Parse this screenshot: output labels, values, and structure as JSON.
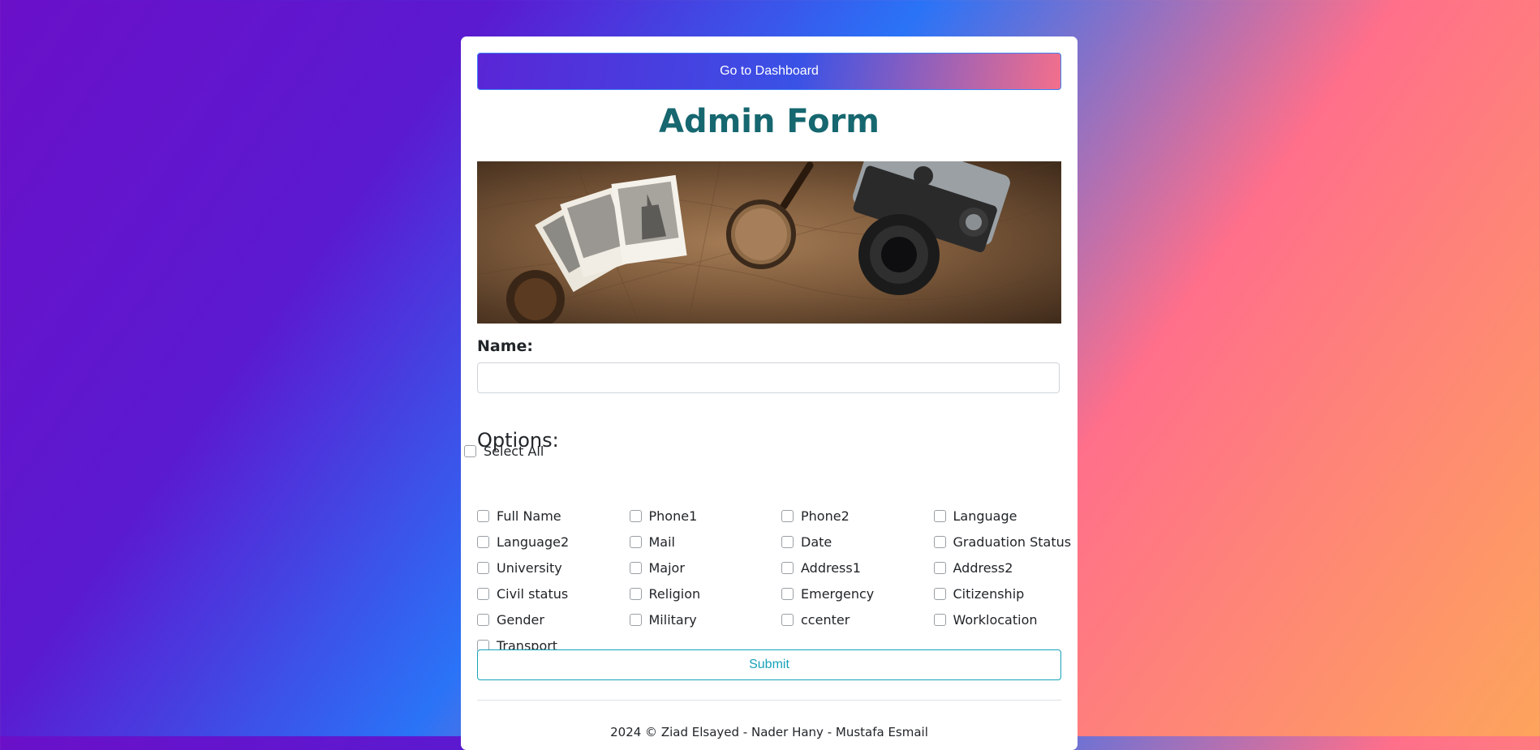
{
  "header": {
    "dashboard_button": "Go to Dashboard"
  },
  "form": {
    "title": "Admin Form",
    "name_label": "Name:",
    "name_value": "",
    "options_title": "Options:",
    "select_all_label": "Select All",
    "options": [
      "Full Name",
      "Phone1",
      "Phone2",
      "Language",
      "Language2",
      "Mail",
      "Date",
      "Graduation Status",
      "University",
      "Major",
      "Address1",
      "Address2",
      "Civil status",
      "Religion",
      "Emergency",
      "Citizenship",
      "Gender",
      "Military",
      "ccenter",
      "Worklocation",
      "Transport"
    ],
    "submit_label": "Submit"
  },
  "banner": {
    "icon": "travel-map-camera-image"
  },
  "footer": {
    "text": "2024 © Ziad Elsayed - Nader Hany - Mustafa Esmail"
  },
  "colors": {
    "title": "#16676f",
    "submit": "#17a2b8",
    "dashboard_gradient_start": "#5a25d6",
    "dashboard_gradient_end": "#f36f8c"
  }
}
